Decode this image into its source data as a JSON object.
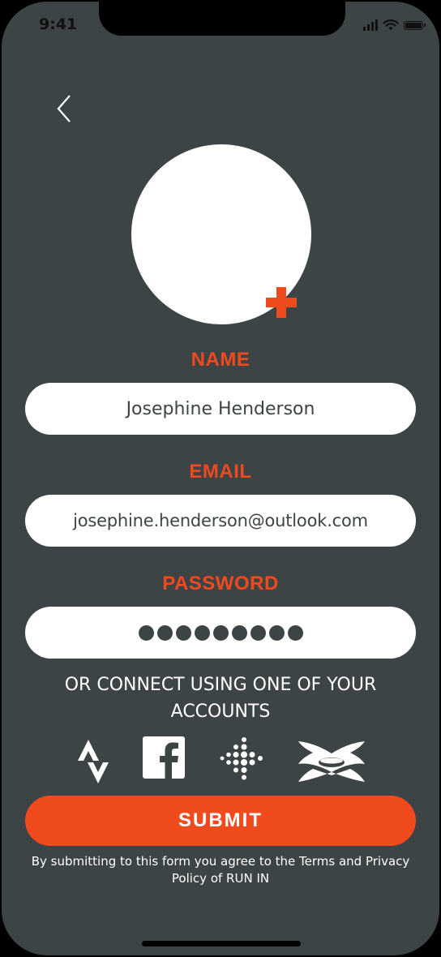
{
  "status_bar": {
    "time": "9:41",
    "icons": [
      "signal-icon",
      "wifi-icon",
      "battery-icon"
    ]
  },
  "header": {
    "back_icon": "chevron-left-icon"
  },
  "profile": {
    "add_photo_icon": "plus-icon"
  },
  "form": {
    "name_label": "NAME",
    "name_value": "Josephine Henderson",
    "email_label": "EMAIL",
    "email_value": "josephine.henderson@outlook.com",
    "password_label": "PASSWORD",
    "password_length": 9
  },
  "connect": {
    "text": "OR CONNECT USING ONE OF YOUR ACCOUNTS",
    "accounts": [
      "strava-icon",
      "facebook-icon",
      "fitbit-icon",
      "under-armour-icon"
    ]
  },
  "submit_label": "SUBMIT",
  "disclaimer": "By submitting to this form you agree to the Terms and Privacy Policy of RUN IN",
  "colors": {
    "background": "#3d4446",
    "accent": "#f04a1f",
    "field": "#ffffff",
    "text_light": "#ffffff"
  }
}
